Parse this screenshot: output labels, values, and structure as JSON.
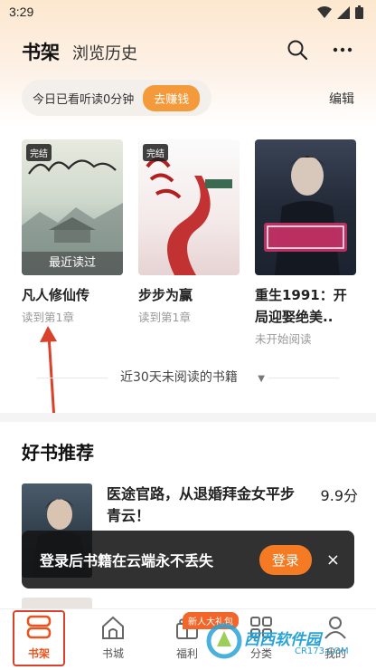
{
  "status": {
    "time": "3:29"
  },
  "header": {
    "tab_active": "书架",
    "tab_other": "浏览历史",
    "reading_today": "今日已看听读0分钟",
    "earn_button": "去赚钱",
    "edit": "编辑"
  },
  "shelf": {
    "books": [
      {
        "title": "凡人修仙传",
        "progress": "读到第1章",
        "badge": "完结",
        "overlay": "最近读过"
      },
      {
        "title": "步步为赢",
        "progress": "读到第1章",
        "badge": "完结"
      },
      {
        "title": "重生1991：开局迎娶绝美..",
        "progress": "未开始阅读"
      }
    ],
    "inactive_label": "近30天未阅读的书籍"
  },
  "recommend": {
    "title": "好书推荐",
    "items": [
      {
        "name": "医途官路，从退婚拜金女平步青云！",
        "score": "9.9分",
        "desc": ""
      },
      {
        "name": "",
        "score": ""
      }
    ]
  },
  "toast": {
    "message": "登录后书籍在云端永不丢失",
    "login": "登录",
    "close": "×"
  },
  "bottom_nav": {
    "items": [
      {
        "label": "书架",
        "icon": "bookshelf-icon"
      },
      {
        "label": "书城",
        "icon": "home-icon"
      },
      {
        "label": "福利",
        "icon": "gift-icon"
      },
      {
        "label": "分类",
        "icon": "grid-icon"
      },
      {
        "label": "我的",
        "icon": "user-icon"
      }
    ],
    "gift_badge": "新人大礼包"
  },
  "watermark": {
    "text": "西西软件园",
    "sub": "CR173.COM"
  },
  "colors": {
    "accent": "#f49a3a",
    "active_nav": "#e8541f",
    "annotation_red": "#d9412b"
  }
}
